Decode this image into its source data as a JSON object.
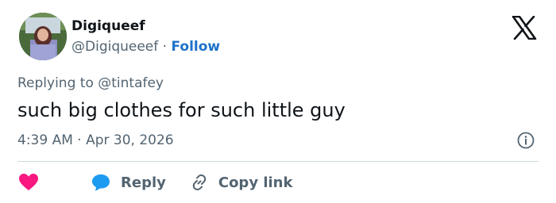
{
  "author": {
    "name": "Digiqueef",
    "handle": "@Digiqueeef",
    "separator": "·",
    "follow_label": "Follow"
  },
  "reply_context": "Replying to @tintafey",
  "tweet": {
    "text": "such big clothes for such little guy",
    "time": "4:39 AM",
    "separator": "·",
    "date": "Apr 30, 2026"
  },
  "actions": {
    "reply_label": "Reply",
    "copy_label": "Copy link"
  },
  "icons": {
    "logo": "x-logo-icon",
    "info": "info-icon",
    "heart": "heart-icon",
    "reply": "speech-bubble-icon",
    "copy": "link-icon"
  },
  "colors": {
    "follow": "#1d72c8",
    "heart": "#f91880",
    "reply": "#1d9bf0",
    "secondary_text": "#536471"
  }
}
